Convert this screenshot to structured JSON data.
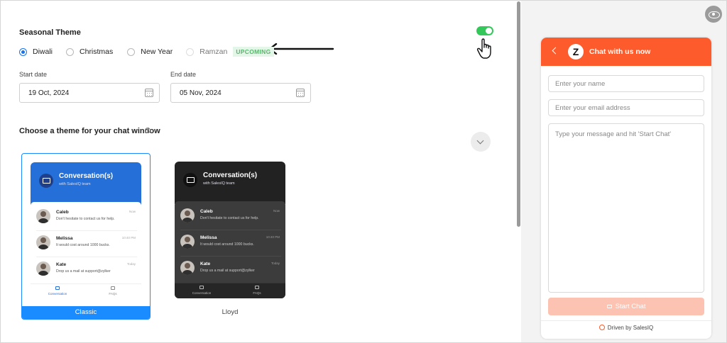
{
  "seasonal": {
    "title": "Seasonal Theme",
    "toggle_on": true,
    "options": [
      {
        "label": "Diwali",
        "selected": true,
        "disabled": false
      },
      {
        "label": "Christmas",
        "selected": false,
        "disabled": false
      },
      {
        "label": "New Year",
        "selected": false,
        "disabled": false
      },
      {
        "label": "Ramzan",
        "selected": false,
        "disabled": true
      }
    ],
    "upcoming_badge": "UPCOMING"
  },
  "dates": {
    "start_label": "Start date",
    "start_value": "19 Oct, 2024",
    "end_label": "End date",
    "end_value": "05 Nov, 2024"
  },
  "themes": {
    "title": "Choose a theme for your chat window",
    "info_icon": "?",
    "items": [
      {
        "name": "Classic",
        "selected": true
      },
      {
        "name": "Lloyd",
        "selected": false
      }
    ],
    "preview": {
      "title": "Conversation(s)",
      "subtitle": "with SalesIQ team",
      "conversations": [
        {
          "name": "Caleb",
          "message": "Don't hesitate to contact us for help.",
          "time": "Now"
        },
        {
          "name": "Melissa",
          "message": "It would cost around 1000 bucks.",
          "time": "10:40 PM"
        },
        {
          "name": "Kate",
          "message": "Drop us a mail at support@zylker",
          "time": "Today"
        }
      ],
      "footer_tabs": [
        "Conversation",
        "FAQs"
      ]
    }
  },
  "widget": {
    "title": "Chat with us now",
    "logo_letter": "Z",
    "name_placeholder": "Enter your name",
    "email_placeholder": "Enter your email address",
    "message_placeholder": "Type your message and hit 'Start Chat'",
    "start_label": "Start Chat",
    "footer": "Driven by SalesIQ",
    "accent_color": "#fe5b2c"
  },
  "colors": {
    "primary": "#1a8cff",
    "toggle": "#34c759",
    "upcoming_text": "#55b86a"
  }
}
